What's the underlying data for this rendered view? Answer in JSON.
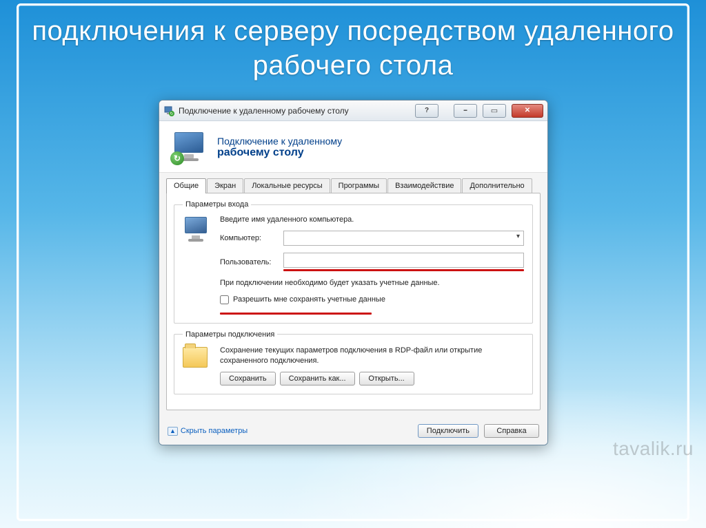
{
  "slide": {
    "title": "подключения к серверу посредством удаленного рабочего стола"
  },
  "window": {
    "title": "Подключение к удаленному рабочему столу",
    "banner_line1": "Подключение к удаленному",
    "banner_line2": "рабочему столу"
  },
  "tabs": [
    {
      "label": "Общие",
      "active": true
    },
    {
      "label": "Экран",
      "active": false
    },
    {
      "label": "Локальные ресурсы",
      "active": false
    },
    {
      "label": "Программы",
      "active": false
    },
    {
      "label": "Взаимодействие",
      "active": false
    },
    {
      "label": "Дополнительно",
      "active": false
    }
  ],
  "login": {
    "legend": "Параметры входа",
    "hint": "Введите имя удаленного компьютера.",
    "computer_label": "Компьютер:",
    "computer_value": "",
    "user_label": "Пользователь:",
    "user_value": "",
    "note": "При подключении необходимо будет указать учетные данные.",
    "remember_label": "Разрешить мне сохранять учетные данные",
    "remember_checked": false
  },
  "connection": {
    "legend": "Параметры подключения",
    "desc": "Сохранение текущих параметров подключения в RDP-файл или открытие сохраненного подключения.",
    "save": "Сохранить",
    "save_as": "Сохранить как...",
    "open": "Открыть..."
  },
  "footer": {
    "hide_params": "Скрыть параметры",
    "connect": "Подключить",
    "help": "Справка"
  },
  "watermark": "tavalik.ru"
}
